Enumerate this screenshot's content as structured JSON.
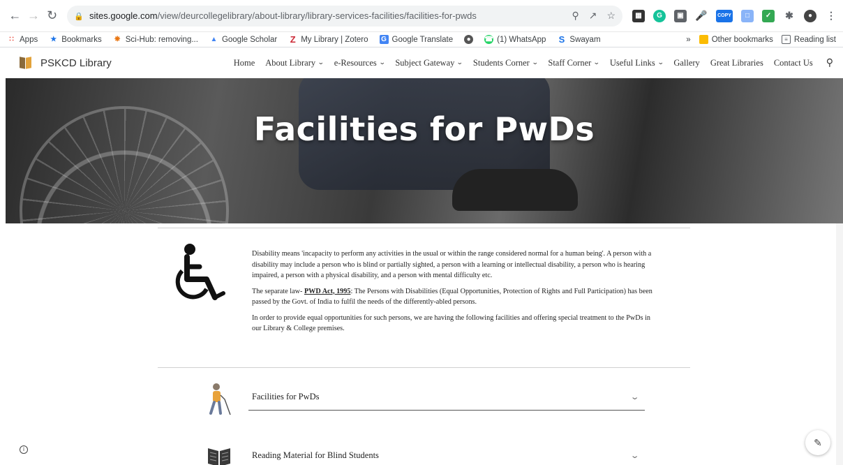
{
  "browser": {
    "url_host": "sites.google.com",
    "url_path": "/view/deurcollegelibrary/about-library/library-services-facilities/facilities-for-pwds",
    "copy_badge": "COPY"
  },
  "bookmarks": {
    "items": [
      {
        "label": "Apps"
      },
      {
        "label": "Bookmarks"
      },
      {
        "label": "Sci-Hub: removing..."
      },
      {
        "label": "Google Scholar"
      },
      {
        "label": "My Library | Zotero"
      },
      {
        "label": "Google Translate"
      },
      {
        "label": "(1) WhatsApp"
      },
      {
        "label": "Swayam"
      }
    ],
    "overflow": "»",
    "other": "Other bookmarks",
    "reading_list": "Reading list"
  },
  "site": {
    "brand": "PSKCD Library",
    "menu": [
      {
        "label": "Home",
        "dropdown": false
      },
      {
        "label": "About Library",
        "dropdown": true
      },
      {
        "label": "e-Resources",
        "dropdown": true
      },
      {
        "label": "Subject Gateway",
        "dropdown": true
      },
      {
        "label": "Students Corner",
        "dropdown": true
      },
      {
        "label": "Staff Corner",
        "dropdown": true
      },
      {
        "label": "Useful Links",
        "dropdown": true
      },
      {
        "label": "Gallery",
        "dropdown": false
      },
      {
        "label": "Great Libraries",
        "dropdown": false
      },
      {
        "label": "Contact Us",
        "dropdown": false
      }
    ]
  },
  "hero": {
    "title": "Facilities for PwDs"
  },
  "intro": {
    "p1": "Disability means 'incapacity to perform any activities in the usual or within the range considered normal for a human being'. A person with a disability may include a person who is blind or partially sighted, a person with a learning or intellectual disability, a person who is hearing impaired, a person with a physical disability, and a person with mental difficulty etc.",
    "p2_prefix": "The separate law- ",
    "p2_link": "PWD Act, 1995",
    "p2_suffix": ": The Persons with Disabilities (Equal Opportunities, Protection of Rights and Full Participation) has been passed by the Govt. of India to fulfil the needs of the differently-abled persons.",
    "p3": "In order to provide equal opportunities for such persons, we are having the following facilities and offering special treatment to the PwDs in our Library & College premises."
  },
  "accordion": [
    {
      "label": "Facilities for PwDs"
    },
    {
      "label": "Reading Material for Blind Students"
    }
  ],
  "colors": {
    "accent_green": "#1e8e3e",
    "brand_orange": "#e2a23a"
  }
}
